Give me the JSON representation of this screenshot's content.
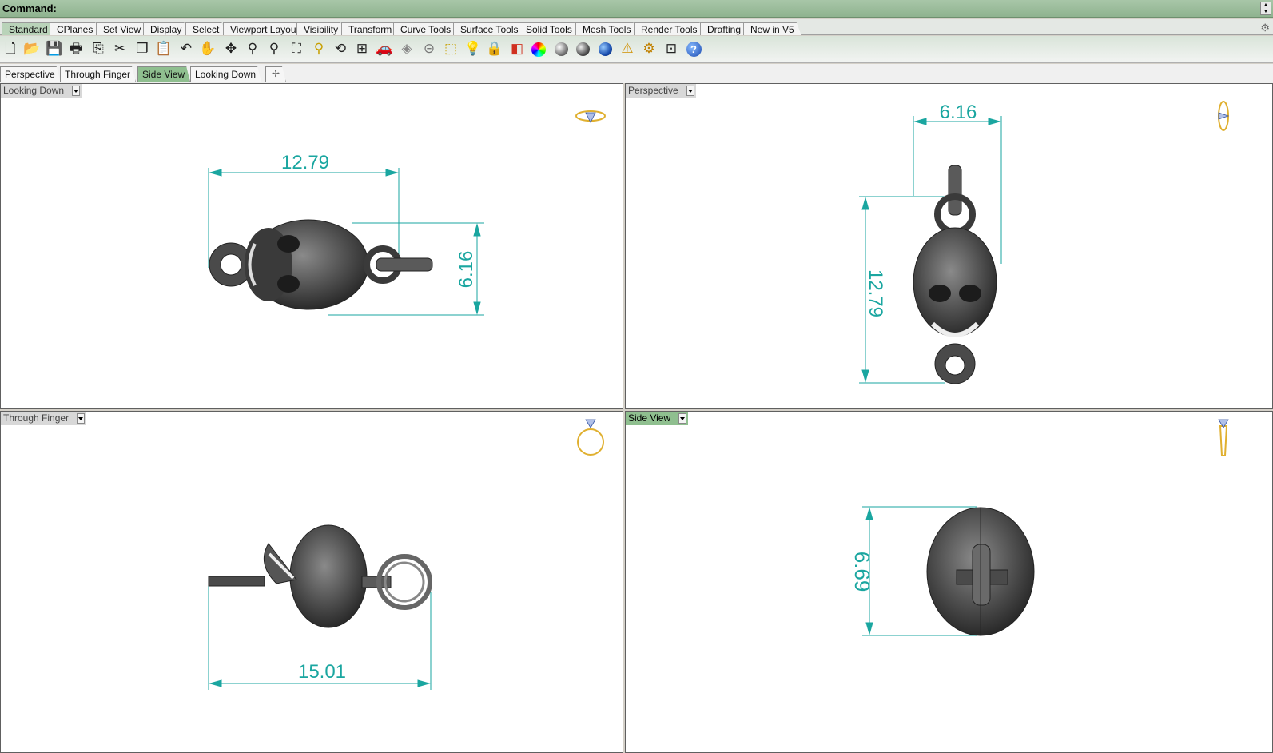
{
  "command": {
    "label": "Command:"
  },
  "toolbar_tabs": [
    "Standard",
    "CPlanes",
    "Set View",
    "Display",
    "Select",
    "Viewport Layout",
    "Visibility",
    "Transform",
    "Curve Tools",
    "Surface Tools",
    "Solid Tools",
    "Mesh Tools",
    "Render Tools",
    "Drafting",
    "New in V5"
  ],
  "toolbar_active_tab": "Standard",
  "icons": [
    "new-icon",
    "open-icon",
    "save-icon",
    "print-icon",
    "import-icon",
    "cut-icon",
    "copy-icon",
    "paste-icon",
    "undo-icon",
    "pan-hand-icon",
    "rotate-view-icon",
    "zoom-icon",
    "zoom-window-icon",
    "zoom-extents-icon",
    "zoom-selected-icon",
    "undo-view-icon",
    "four-viewports-icon",
    "car-icon",
    "hide-icon",
    "show-icon",
    "layer-icon",
    "light-icon",
    "lock-icon",
    "layers-icon",
    "color-wheel-icon",
    "shaded-icon",
    "rendered-icon",
    "render-icon",
    "options-icon",
    "settings-gear-icon",
    "dimension-icon",
    "help-icon"
  ],
  "viewport_tabs": [
    "Perspective",
    "Through Finger",
    "Side View",
    "Looking Down"
  ],
  "viewport_active_tab": "Side View",
  "viewports": {
    "top_left": {
      "title": "Looking Down",
      "dim_horizontal": "12.79",
      "dim_vertical": "6.16"
    },
    "top_right": {
      "title": "Perspective",
      "dim_horizontal": "6.16",
      "dim_vertical": "12.79"
    },
    "bottom_left": {
      "title": "Through Finger",
      "dim_horizontal": "15.01"
    },
    "bottom_right": {
      "title": "Side View",
      "dim_vertical": "6.69"
    }
  },
  "colors": {
    "accent_green": "#8fbf8f",
    "dimension": "#1aa6a0",
    "model": "#4a4a4a",
    "ring_gold": "#e0b030"
  }
}
